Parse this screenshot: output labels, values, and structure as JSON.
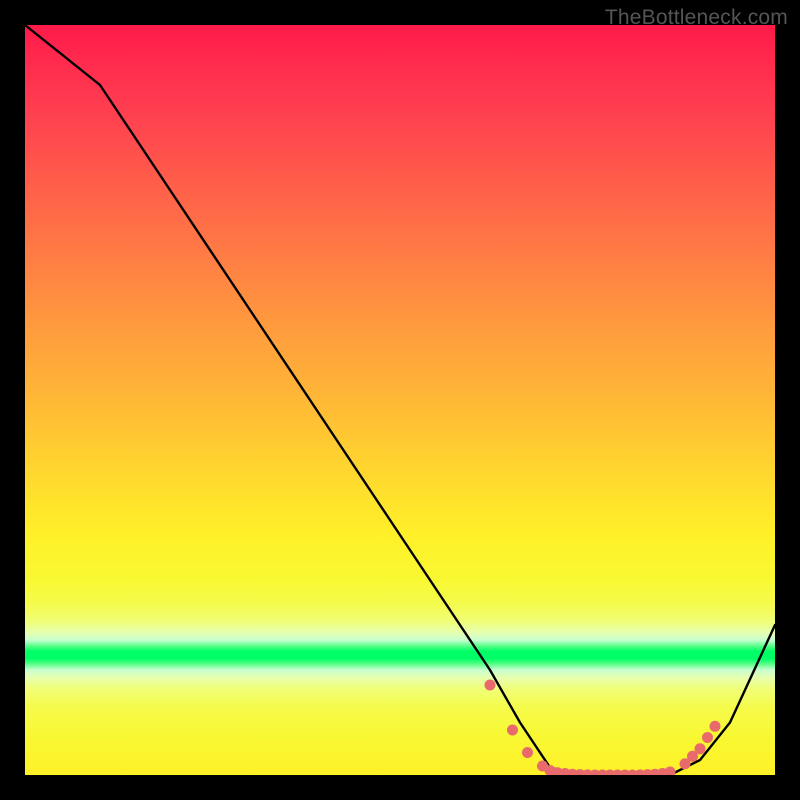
{
  "watermark": "TheBottleneck.com",
  "chart_data": {
    "type": "line",
    "title": "",
    "xlabel": "",
    "ylabel": "",
    "xlim": [
      0,
      100
    ],
    "ylim": [
      0,
      100
    ],
    "series": [
      {
        "name": "curve",
        "x": [
          0,
          10,
          20,
          30,
          40,
          50,
          58,
          62,
          66,
          70,
          74,
          78,
          82,
          86,
          90,
          94,
          100
        ],
        "y": [
          100,
          92,
          77,
          62,
          47,
          32,
          20,
          14,
          7,
          1,
          0,
          0,
          0,
          0,
          2,
          7,
          20
        ]
      }
    ],
    "markers": {
      "name": "dots",
      "color": "#e86a6a",
      "x": [
        62,
        65,
        67,
        69,
        70,
        71,
        72,
        73,
        74,
        75,
        76,
        77,
        78,
        79,
        80,
        81,
        82,
        83,
        84,
        85,
        86,
        88,
        89,
        90,
        91,
        92
      ],
      "y": [
        12,
        6,
        3,
        1.2,
        0.6,
        0.3,
        0.2,
        0.1,
        0.05,
        0.02,
        0,
        0,
        0,
        0,
        0,
        0,
        0.02,
        0.05,
        0.1,
        0.2,
        0.4,
        1.5,
        2.5,
        3.5,
        5,
        6.5
      ]
    },
    "gradient_band_center_y_pct": 83.5
  }
}
